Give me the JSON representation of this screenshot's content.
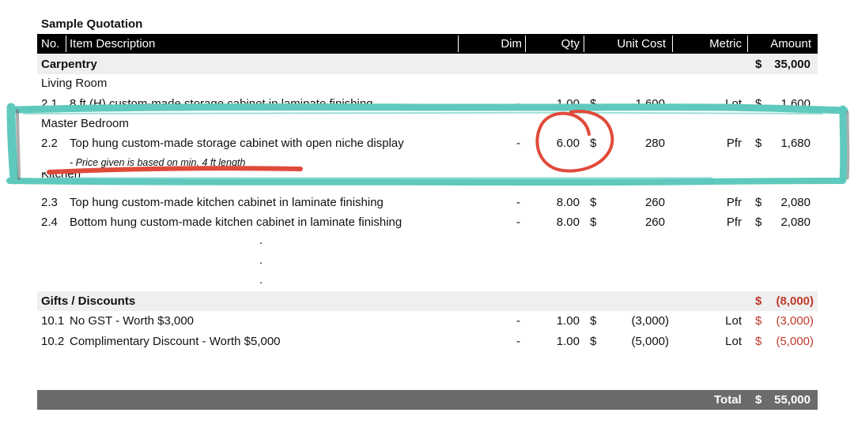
{
  "document": {
    "title": "Sample Quotation"
  },
  "header": {
    "no": "No.",
    "item_description": "Item Description",
    "dim": "Dim",
    "qty": "Qty",
    "unit_cost": "Unit Cost",
    "metric": "Metric",
    "amount": "Amount"
  },
  "sections": {
    "carpentry": {
      "label": "Carpentry",
      "currency": "$",
      "amount": "35,000"
    },
    "gifts": {
      "label": "Gifts / Discounts",
      "currency": "$",
      "amount": "(8,000)"
    }
  },
  "groups": {
    "living_room": "Living Room",
    "master_bedroom": "Master Bedroom",
    "kitchen": "Kitchen"
  },
  "items": [
    {
      "no": "2.1",
      "desc": "8 ft (H) custom-made storage cabinet in laminate finishing",
      "dim": "-",
      "qty": "1.00",
      "cur": "$",
      "unit_cost": "1,600",
      "metric": "Lot",
      "amt_cur": "$",
      "amount": "1,600"
    },
    {
      "no": "2.2",
      "desc": "Top hung custom-made storage cabinet with open niche display",
      "dim": "-",
      "qty": "6.00",
      "cur": "$",
      "unit_cost": "280",
      "metric": "Pfr",
      "amt_cur": "$",
      "amount": "1,680"
    },
    {
      "no": "2.3",
      "desc": "Top hung custom-made kitchen cabinet in laminate finishing",
      "dim": "-",
      "qty": "8.00",
      "cur": "$",
      "unit_cost": "260",
      "metric": "Pfr",
      "amt_cur": "$",
      "amount": "2,080"
    },
    {
      "no": "2.4",
      "desc": "Bottom hung custom-made kitchen cabinet in laminate finishing",
      "dim": "-",
      "qty": "8.00",
      "cur": "$",
      "unit_cost": "260",
      "metric": "Pfr",
      "amt_cur": "$",
      "amount": "2,080"
    },
    {
      "no": "10.1",
      "desc": "No GST - Worth $3,000",
      "dim": "-",
      "qty": "1.00",
      "cur": "$",
      "unit_cost": "(3,000)",
      "metric": "Lot",
      "amt_cur": "$",
      "amount": "(3,000)"
    },
    {
      "no": "10.2",
      "desc": "Complimentary Discount - Worth $5,000",
      "dim": "-",
      "qty": "1.00",
      "cur": "$",
      "unit_cost": "(5,000)",
      "metric": "Lot",
      "amt_cur": "$",
      "amount": "(5,000)"
    }
  ],
  "note_2_2": "- Price given is based on min. 4 ft length",
  "ellipsis": ".",
  "total": {
    "label": "Total",
    "currency": "$",
    "amount": "55,000"
  },
  "colors": {
    "header_bg": "#000000",
    "band_bg": "#efefef",
    "discount_red": "#c0392b",
    "total_bg": "#6b6b6b",
    "highlight_teal": "#5fc9bd",
    "annotation_red": "#e04a3a"
  }
}
